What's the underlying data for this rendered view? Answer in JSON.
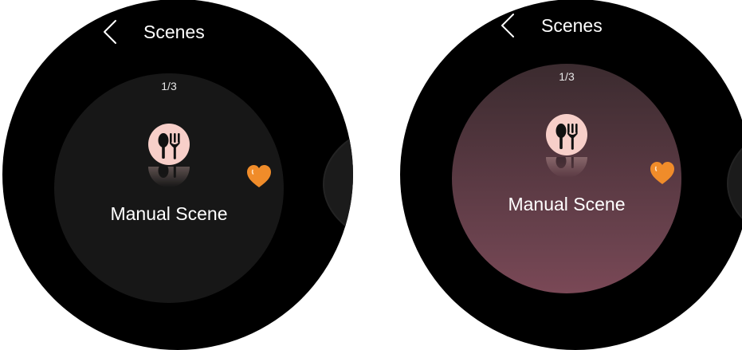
{
  "screens": [
    {
      "header": {
        "title": "Scenes",
        "back_icon": "chevron-left-icon"
      },
      "card": {
        "page_indicator": "1/3",
        "scene_icon": "fork-spoon-icon",
        "scene_name": "Manual Scene",
        "favorite_icon": "heart-icon",
        "style": "dark"
      }
    },
    {
      "header": {
        "title": "Scenes",
        "back_icon": "chevron-left-icon"
      },
      "card": {
        "page_indicator": "1/3",
        "scene_icon": "fork-spoon-icon",
        "scene_name": "Manual Scene",
        "favorite_icon": "heart-icon",
        "style": "rose-gradient"
      }
    }
  ],
  "colors": {
    "background": "#000000",
    "card_dark": "#171717",
    "card_gradient_top": "#3b2b2f",
    "card_gradient_bottom": "#7a4856",
    "favorite": "#f08c2a",
    "scene_icon_bg": "#f7cfc9",
    "text": "#ffffff"
  }
}
